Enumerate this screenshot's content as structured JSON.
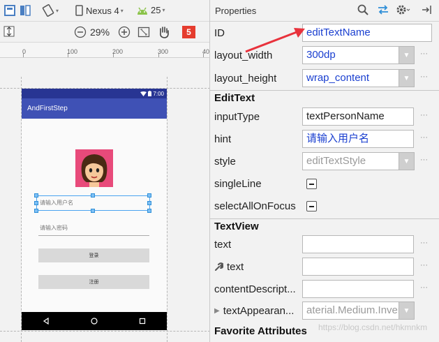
{
  "editor": {
    "toolbar1": {
      "device": "Nexus 4",
      "api": "25"
    },
    "toolbar2": {
      "zoom": "29%",
      "error_count": "5"
    },
    "ruler": {
      "ticks": [
        "0",
        "100",
        "200",
        "300",
        "40"
      ]
    },
    "phone": {
      "status_time": "7:00",
      "app_title": "AndFirstStep",
      "username_hint": "请输入用户名",
      "password_hint": "请输入密码",
      "login_label": "登录",
      "register_label": "注册"
    }
  },
  "properties": {
    "title": "Properties",
    "rows": [
      {
        "label": "ID",
        "value": "editTextName"
      },
      {
        "label": "layout_width",
        "value": "300dp"
      },
      {
        "label": "layout_height",
        "value": "wrap_content"
      }
    ],
    "edittext_section": "EditText",
    "edittext_rows": [
      {
        "label": "inputType",
        "value": "textPersonName"
      },
      {
        "label": "hint",
        "value": "请输入用户名"
      },
      {
        "label": "style",
        "value": "editTextStyle"
      },
      {
        "label": "singleLine"
      },
      {
        "label": "selectAllOnFocus"
      }
    ],
    "textview_section": "TextView",
    "textview_rows": [
      {
        "label": "text",
        "value": ""
      },
      {
        "label": "text",
        "value": ""
      },
      {
        "label": "contentDescript...",
        "value": ""
      },
      {
        "label": "textAppearan...",
        "value": "aterial.Medium.Inverse"
      }
    ],
    "favorite_section": "Favorite Attributes",
    "watermark": "https://blog.csdn.net/hkmnkm"
  },
  "colors": {
    "accent_arrow": "#e8323c",
    "appbar": "#3f51b5",
    "statusbar": "#283593",
    "value_blue": "#1a3fd0",
    "avatar_bg": "#e84a7a"
  },
  "icons": [
    "design-view-icon",
    "blueprint-icon",
    "orientation-icon",
    "device-icon",
    "android-icon",
    "resize-icon",
    "zoom-out-icon",
    "zoom-in-icon",
    "fit-screen-icon",
    "pan-hand-icon",
    "error-badge-icon",
    "search-icon",
    "swap-icon",
    "gear-icon",
    "pin-icon",
    "wrench-icon",
    "expand-arrow-icon",
    "back-nav-icon",
    "home-nav-icon",
    "recents-nav-icon",
    "wifi-icon",
    "battery-icon"
  ]
}
